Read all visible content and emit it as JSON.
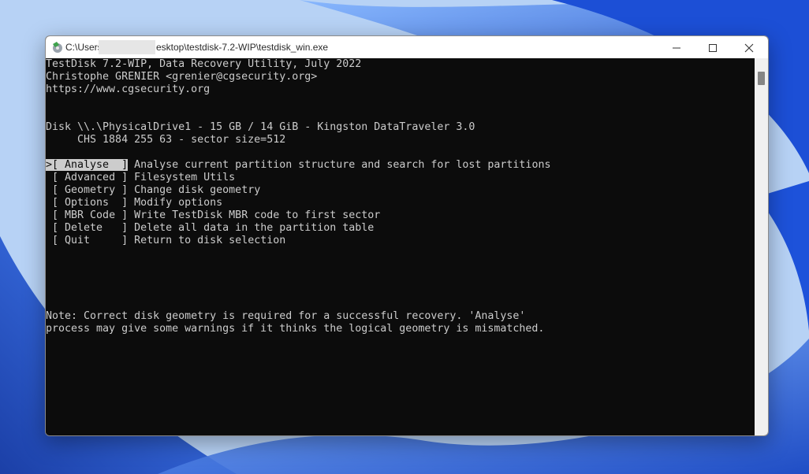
{
  "window": {
    "title_prefix": "C:\\Users",
    "title_suffix": "esktop\\testdisk-7.2-WIP\\testdisk_win.exe"
  },
  "console": {
    "header": [
      "TestDisk 7.2-WIP, Data Recovery Utility, July 2022",
      "Christophe GRENIER <grenier@cgsecurity.org>",
      "https://www.cgsecurity.org"
    ],
    "disk_line": "Disk \\\\.\\PhysicalDrive1 - 15 GB / 14 GiB - Kingston DataTraveler 3.0",
    "chs_line": "     CHS 1884 255 63 - sector size=512",
    "menu": {
      "cursor": ">",
      "items": [
        {
          "button": "[ Analyse  ]",
          "desc": " Analyse current partition structure and search for lost partitions"
        },
        {
          "button": "[ Advanced ]",
          "desc": " Filesystem Utils"
        },
        {
          "button": "[ Geometry ]",
          "desc": " Change disk geometry"
        },
        {
          "button": "[ Options  ]",
          "desc": " Modify options"
        },
        {
          "button": "[ MBR Code ]",
          "desc": " Write TestDisk MBR code to first sector"
        },
        {
          "button": "[ Delete   ]",
          "desc": " Delete all data in the partition table"
        },
        {
          "button": "[ Quit     ]",
          "desc": " Return to disk selection"
        }
      ]
    },
    "note": [
      "Note: Correct disk geometry is required for a successful recovery. 'Analyse'",
      "process may give some warnings if it thinks the logical geometry is mismatched."
    ]
  },
  "colors": {
    "console_bg": "#0c0c0c",
    "console_fg": "#cccccc",
    "highlight_bg": "#cccccc",
    "titlebar_bg": "#ffffff",
    "wallpaper_accent": "#1f55d9"
  },
  "icons": {
    "app": "testdisk-app-icon",
    "minimize": "minimize-icon",
    "maximize": "maximize-icon",
    "close": "close-icon"
  }
}
